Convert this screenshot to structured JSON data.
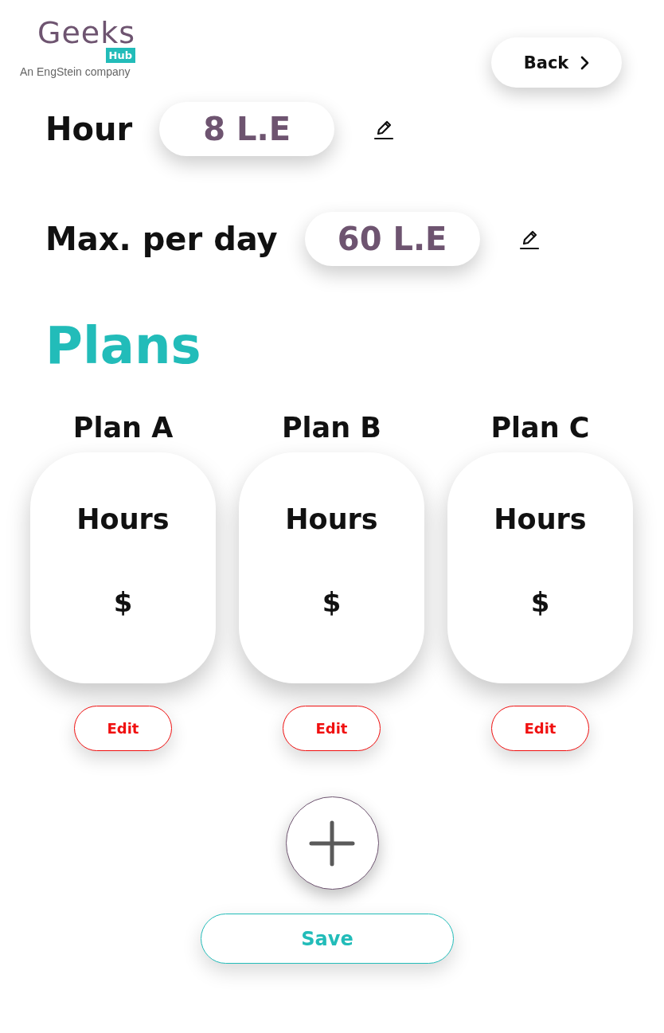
{
  "logo": {
    "name": "Geeks",
    "badge": "Hub",
    "tagline": "An EngStein company"
  },
  "back_button": {
    "label": "Back"
  },
  "rates": [
    {
      "label": "Hour",
      "value": "8 L.E"
    },
    {
      "label": "Max. per day",
      "value": "60 L.E"
    }
  ],
  "plans_title": "Plans",
  "plans": [
    {
      "name": "Plan A",
      "hours": "Hours",
      "price": "$",
      "edit": "Edit"
    },
    {
      "name": "Plan B",
      "hours": "Hours",
      "price": "$",
      "edit": "Edit"
    },
    {
      "name": "Plan C",
      "hours": "Hours",
      "price": "$",
      "edit": "Edit"
    }
  ],
  "save_button": {
    "label": "Save"
  }
}
